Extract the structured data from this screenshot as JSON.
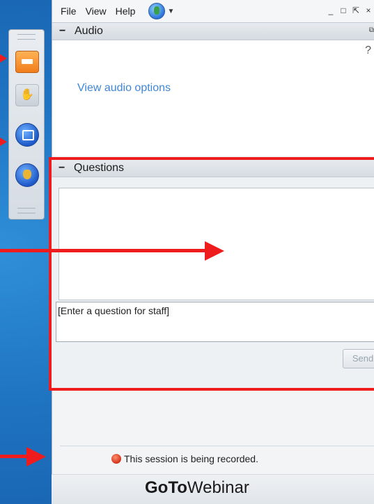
{
  "menu": {
    "file": "File",
    "view": "View",
    "help": "Help"
  },
  "window_controls": {
    "minimize": "_",
    "restore": "□",
    "popout": "⇱",
    "close": "×"
  },
  "audio": {
    "title": "Audio",
    "help": "?",
    "link": "View audio options"
  },
  "questions": {
    "title": "Questions",
    "placeholder": "[Enter a question for staff]",
    "send": "Send"
  },
  "status": {
    "recording": "This session is being recorded."
  },
  "brand": {
    "bold": "GoTo",
    "rest": "Webinar"
  },
  "colors": {
    "annotation": "#ee1c1c",
    "link": "#3f86d8",
    "background": "#1e72c0"
  },
  "icons": [
    "arrow-right-icon",
    "raise-hand-icon",
    "screen-icon",
    "globe-icon",
    "recording-dot-icon"
  ]
}
